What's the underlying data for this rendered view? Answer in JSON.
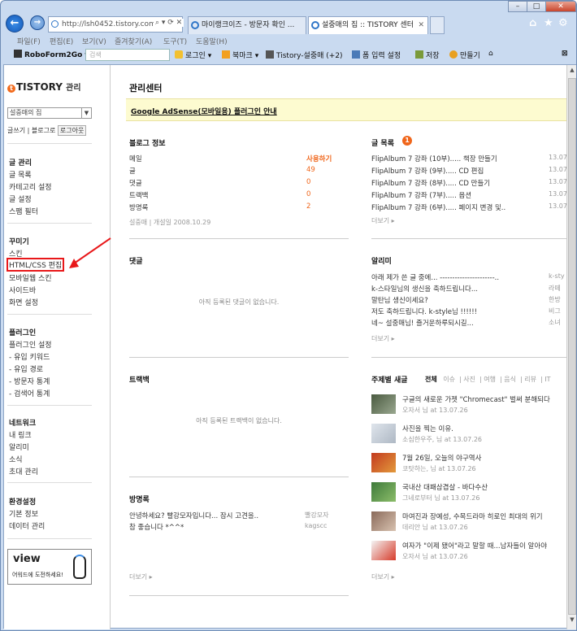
{
  "browser": {
    "address": "http://lsh0452.tistory.com/",
    "tabs": [
      {
        "title": "마이랭크이즈 - 방문자 확인 ..."
      },
      {
        "title": "설중매의 집 :: TISTORY 센터"
      }
    ],
    "menu": [
      "파일(F)",
      "편집(E)",
      "보기(V)",
      "즐겨찾기(A)",
      "도구(T)",
      "도움말(H)"
    ],
    "toolbar": {
      "roboform": "RoboForm2Go",
      "search_placeholder": "검색",
      "login": "로그인",
      "bookmark": "북마크",
      "tistory_tab": "Tistory-설중매 (+2)",
      "form_fill": "폼 입력 설정",
      "save": "저장",
      "make": "만들기"
    }
  },
  "sidebar": {
    "logo": "TISTORY",
    "logo_sub": "관리",
    "blog_select": "설중매의 집",
    "links": {
      "write": "글쓰기",
      "blog": "블로그로",
      "logout": "로그아웃"
    },
    "sections": [
      {
        "title": "글 관리",
        "items": [
          "글 목록",
          "카테고리 설정",
          "글 설정",
          "스팸 필터"
        ]
      },
      {
        "title": "꾸미기",
        "items": [
          "스킨",
          "HTML/CSS 편집",
          "모바일웹 스킨",
          "사이드바",
          "화면 설정"
        ]
      },
      {
        "title": "플러그인",
        "items": [
          "플러그인 설정",
          "- 유입 키워드",
          "- 유입 경로",
          "- 방문자 통계",
          "- 검색어 통계"
        ]
      },
      {
        "title": "네트워크",
        "items": [
          "내 링크",
          "알리미",
          "소식",
          "초대 관리"
        ]
      },
      {
        "title": "환경설정",
        "items": [
          "기본 정보",
          "데이터 관리"
        ]
      }
    ],
    "banner": {
      "title": "view",
      "sub": "어워드에 도전하세요!"
    }
  },
  "main": {
    "title": "관리센터",
    "notice": "Google AdSense(모바일용) 플러그인 안내",
    "blog_info": {
      "title": "블로그 정보",
      "rows": [
        {
          "label": "메일",
          "value": "사용하기"
        },
        {
          "label": "글",
          "value": "49"
        },
        {
          "label": "댓글",
          "value": "0"
        },
        {
          "label": "트랙백",
          "value": "0"
        },
        {
          "label": "방명록",
          "value": "2"
        }
      ],
      "footer": "설중매 | 개설일 2008.10.29"
    },
    "post_list": {
      "title": "글 목록",
      "badge": "1",
      "rows": [
        {
          "title": "FlipAlbum 7 강좌 (10부)..... 책장 만들기",
          "date": "13.07"
        },
        {
          "title": "FlipAlbum 7 강좌 (9부)..... CD 편집",
          "date": "13.07"
        },
        {
          "title": "FlipAlbum 7 강좌 (8부)..... CD 만들기",
          "date": "13.07"
        },
        {
          "title": "FlipAlbum 7 강좌 (7부)..... 옵션",
          "date": "13.07"
        },
        {
          "title": "FlipAlbum 7 강좌 (6부)..... 페이지 변경 및..",
          "date": "13.07"
        }
      ],
      "more": "더보기"
    },
    "comments": {
      "title": "댓글",
      "empty": "아직 등록된 댓글이 없습니다."
    },
    "alerts": {
      "title": "알리미",
      "rows": [
        {
          "text": "아래 제가 쓴 글 중에... ----------------------..",
          "who": "k-sty"
        },
        {
          "text": "k-스타일님의 생신을 축하드립니다...",
          "who": "라떼"
        },
        {
          "text": "말탄님 생신이세요?",
          "who": "한방"
        },
        {
          "text": "저도 축하드립니다. k-style님 !!!!!!",
          "who": "비그"
        },
        {
          "text": "네~ 설중매님! 즐거운하루되시길...",
          "who": "소녀"
        }
      ],
      "more": "더보기"
    },
    "trackback": {
      "title": "트랙백",
      "empty": "아직 등록된 트랙백이 없습니다."
    },
    "topic": {
      "title": "주제별 새글",
      "tabs": [
        "전체",
        "이슈",
        "사진",
        "여행",
        "음식",
        "리뷰",
        "IT"
      ],
      "rows": [
        {
          "title": "구글의 새로운 가젯 \"Chromecast\" 벌써 분해되다",
          "meta": "오자서 님 at 13.07.26"
        },
        {
          "title": "사진을 찍는 이유.",
          "meta": "소심한우주, 님 at 13.07.26"
        },
        {
          "title": "7월 26일, 오늘의 야구역사",
          "meta": "코탓하는, 님 at 13.07.26"
        },
        {
          "title": "국내산 대패삼겹살 - 바다수산",
          "meta": "그네로부터 님 at 13.07.26"
        },
        {
          "title": "마여진과 장예성, 수목드라마 히로인 최대의 위기",
          "meta": "데리안 님 at 13.07.26"
        },
        {
          "title": "여자가 \"이제 됐어\"라고 말할 때...남자들이 알아야",
          "meta": "오자서 님 at 13.07.26"
        }
      ],
      "more": "더보기"
    },
    "guestbook": {
      "title": "방명록",
      "rows": [
        {
          "text": "안녕하세요? 빨강모자입니다... 잠시 고견을..",
          "who": "빨강모자"
        },
        {
          "text": "참 좋습니다 *^^*",
          "who": "kagscc"
        }
      ],
      "more": "더보기"
    }
  },
  "colors": {
    "accent": "#f0661b",
    "highlight": "#e8181a",
    "notice_bg": "#fdfbd0"
  }
}
